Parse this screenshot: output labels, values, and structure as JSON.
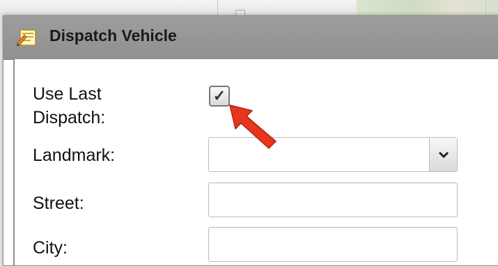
{
  "dialog": {
    "title": "Dispatch Vehicle",
    "icon": "dispatch-form-icon"
  },
  "form": {
    "use_last_dispatch": {
      "label_line1": "Use Last",
      "label_line2": "Dispatch:",
      "checked": true,
      "check_glyph": "✓"
    },
    "landmark": {
      "label": "Landmark:",
      "value": ""
    },
    "street": {
      "label": "Street:",
      "value": ""
    },
    "city": {
      "label": "City:",
      "value": ""
    }
  },
  "annotation": {
    "icon": "red-arrow-icon",
    "color": "#e8351e"
  },
  "colors": {
    "titlebar": "#969696",
    "arrow": "#e8351e"
  }
}
